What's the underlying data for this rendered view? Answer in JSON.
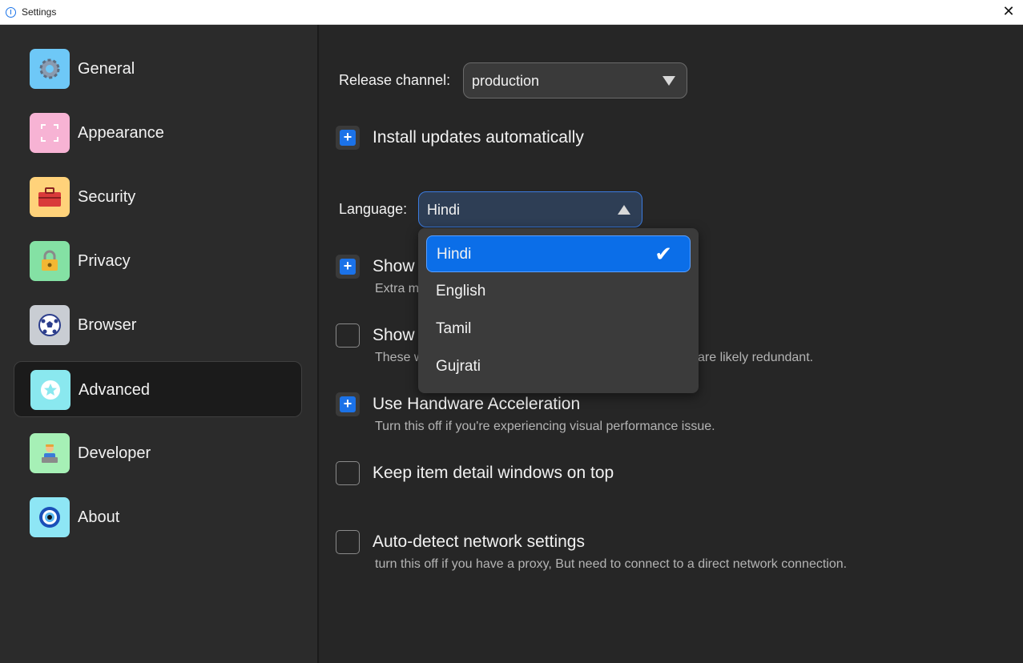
{
  "window": {
    "title": "Settings",
    "close_glyph": "✕"
  },
  "sidebar": {
    "items": [
      {
        "label": "General",
        "icon": "gear-icon",
        "color": "#6ec8f7"
      },
      {
        "label": "Appearance",
        "icon": "frame-icon",
        "color": "#f7b3d4"
      },
      {
        "label": "Security",
        "icon": "toolbox-icon",
        "color": "#ffd27a"
      },
      {
        "label": "Privacy",
        "icon": "lock-icon",
        "color": "#84e1a4"
      },
      {
        "label": "Browser",
        "icon": "ball-icon",
        "color": "#c9cdd3"
      },
      {
        "label": "Advanced",
        "icon": "star-icon",
        "color": "#8ae8ef"
      },
      {
        "label": "Developer",
        "icon": "developer-icon",
        "color": "#a6f0b6"
      },
      {
        "label": "About",
        "icon": "eye-icon",
        "color": "#8ee6f5"
      }
    ],
    "active": "Advanced"
  },
  "release": {
    "label": "Release channel:",
    "value": "production"
  },
  "auto_update": {
    "label": "Install updates automatically",
    "checked": true,
    "glyph": "+"
  },
  "language": {
    "label": "Language:",
    "value": "Hindi",
    "options": [
      "Hindi",
      "English",
      "Tamil",
      "Gujrati"
    ],
    "check_glyph": "✔"
  },
  "options": {
    "show1": {
      "title": "Show",
      "desc": "Extra m",
      "checked": true
    },
    "show2": {
      "title": "Show",
      "desc": "These w",
      "desc_tail": "are likely redundant.",
      "checked": false
    },
    "hw": {
      "title": "Use Handware Acceleration",
      "desc": "Turn this off if you're experiencing visual performance issue.",
      "checked": true
    },
    "keep": {
      "title": "Keep item detail windows on top",
      "checked": false
    },
    "network": {
      "title": "Auto-detect network settings",
      "desc": "turn this off if you have a proxy, But need to connect to a direct network connection.",
      "checked": false
    }
  },
  "colors": {
    "accent": "#1b72e8",
    "background": "#262626",
    "sidebar": "#2b2b2b"
  }
}
